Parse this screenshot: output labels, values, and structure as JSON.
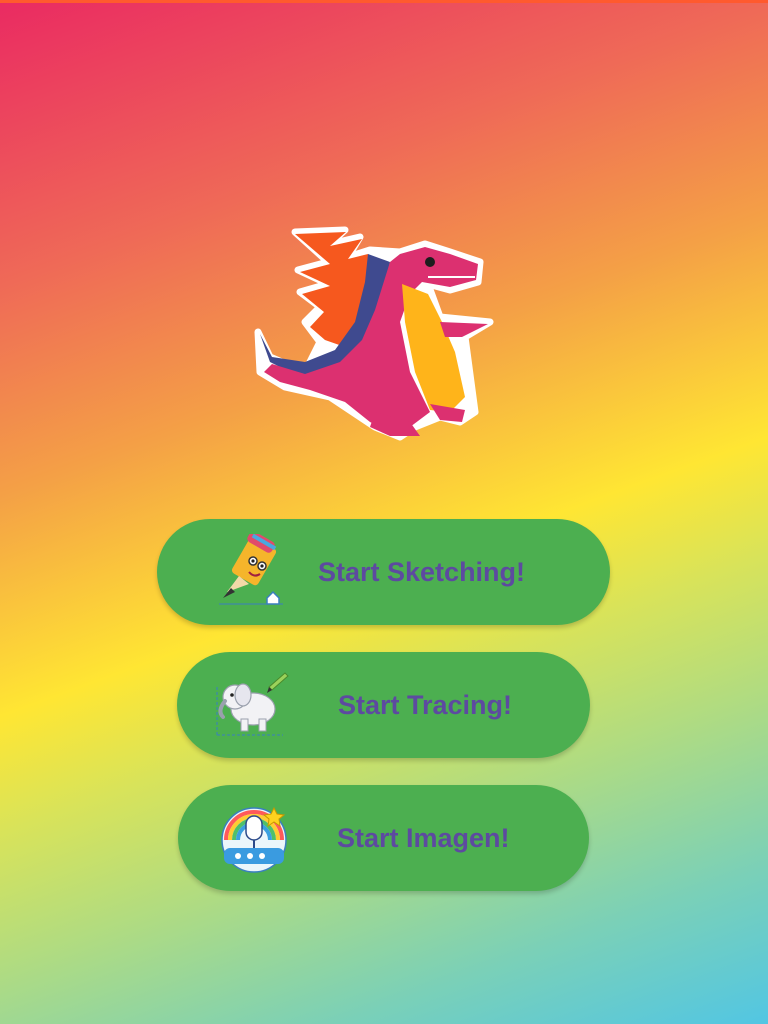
{
  "app": {
    "mascot_icon": "dragon-mascot",
    "top_bar_color": "#ff5a2e"
  },
  "menu": {
    "buttons": [
      {
        "label": "Start Sketching!",
        "icon": "pencil-character-icon"
      },
      {
        "label": "Start Tracing!",
        "icon": "elephant-tracing-icon"
      },
      {
        "label": "Start Imagen!",
        "icon": "microphone-rainbow-icon"
      }
    ],
    "button_color": "#4caf50",
    "label_color": "#5d4aa0"
  }
}
